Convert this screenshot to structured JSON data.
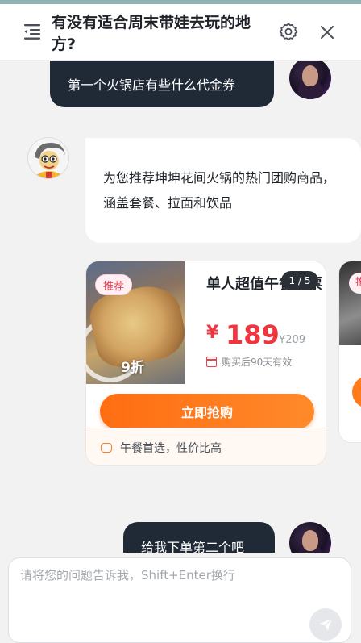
{
  "header": {
    "title": "有没有适合周末带娃去玩的地方?",
    "menu_icon": "collapse-menu-icon",
    "settings_icon": "gear-icon",
    "close_icon": "close-icon"
  },
  "messages": {
    "user_1": "第一个火锅店有些什么代金券",
    "bot_1": "为您推荐坤坤花间火锅的热门团购商品，涵盖套餐、拉面和饮品",
    "user_2": "给我下单第二个吧"
  },
  "product_card": {
    "tag": "推荐",
    "discount": "9折",
    "name": "单人超值午餐套票",
    "pager": "1 / 5",
    "currency": "¥",
    "price": "189",
    "original_price": "¥209",
    "validity": "购买后90天有效",
    "buy_label": "立即抢购",
    "footer_note": "午餐首选，性价比高"
  },
  "next_card": {
    "tag": "推"
  },
  "input": {
    "placeholder": "请将您的问题告诉我，Shift+Enter换行",
    "value": ""
  },
  "colors": {
    "user_bubble": "#1f2a36",
    "accent_orange": "#ff6d12",
    "price_red": "#f0353f"
  }
}
